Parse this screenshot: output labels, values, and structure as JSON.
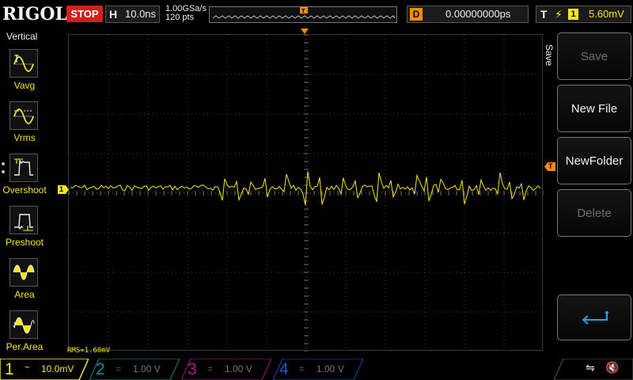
{
  "topbar": {
    "brand": "RIGOL",
    "run_state": "STOP",
    "horizontal": {
      "key": "H",
      "timebase": "10.0ns"
    },
    "sample_rate": "1.00GSa/s",
    "points": "120 pts",
    "delay": {
      "key": "D",
      "value": "0.00000000ps"
    },
    "trigger": {
      "key": "T",
      "edge_symbol": "⚡",
      "source": "1",
      "level": "5.60mV"
    }
  },
  "left_panel": {
    "title": "Vertical",
    "items": [
      {
        "label": "Vavg",
        "icon": "vavg-waveform-icon"
      },
      {
        "label": "Vrms",
        "icon": "vrms-waveform-icon"
      },
      {
        "label": "Overshoot",
        "icon": "overshoot-waveform-icon"
      },
      {
        "label": "Preshoot",
        "icon": "preshoot-waveform-icon"
      },
      {
        "label": "Area",
        "icon": "area-waveform-icon"
      },
      {
        "label": "Per.Area",
        "icon": "period-area-waveform-icon"
      }
    ]
  },
  "screen": {
    "measurement_readout": "RMS=1.60mV",
    "ch1_marker": "1",
    "trigger_marker": "T",
    "trace_color": "#f5e61e"
  },
  "right_menu": {
    "tab_label": "Save",
    "buttons": [
      {
        "label": "Save",
        "enabled": false
      },
      {
        "label": "New File",
        "enabled": true
      },
      {
        "label": "NewFolder",
        "enabled": true
      },
      {
        "label": "Delete",
        "enabled": false
      }
    ],
    "back_icon": "return-arrow-icon"
  },
  "bottombar": {
    "channels": [
      {
        "num": "1",
        "coupling": "~",
        "scale": "10.0mV",
        "active": true,
        "color": "#f5e61e"
      },
      {
        "num": "2",
        "coupling": "=",
        "scale": "1.00 V",
        "active": false,
        "color": "#1c8a8a"
      },
      {
        "num": "3",
        "coupling": "=",
        "scale": "1.00 V",
        "active": false,
        "color": "#b0208f"
      },
      {
        "num": "4",
        "coupling": "=",
        "scale": "1.00 V",
        "active": false,
        "color": "#1f58c0"
      }
    ],
    "usb_icon": "usb-icon",
    "mute_icon": "speaker-muted-icon"
  }
}
